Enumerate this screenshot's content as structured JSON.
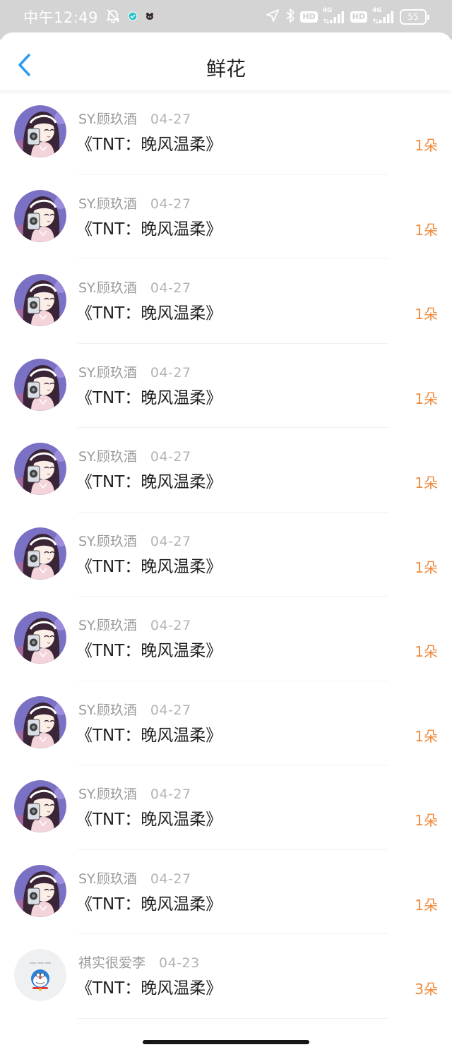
{
  "status_bar": {
    "time": "中午12:49",
    "left_icons": [
      "bell-slash-icon",
      "check-circle-icon",
      "app-notification-icon"
    ],
    "right_icons": [
      "location-arrow-icon",
      "bluetooth-icon"
    ],
    "hd_label": "HD",
    "network_label": "4G",
    "battery_level": "55"
  },
  "header": {
    "title": "鲜花",
    "back_icon": "chevron-left-icon",
    "accent_color": "#2b9cf0"
  },
  "list": {
    "amount_color": "#f08a3c",
    "items": [
      {
        "avatar": "anime-girl-avatar",
        "name": "SY.顾玖酒",
        "date": "04-27",
        "title": "《TNT：晚风温柔》",
        "amount": "1朵"
      },
      {
        "avatar": "anime-girl-avatar",
        "name": "SY.顾玖酒",
        "date": "04-27",
        "title": "《TNT：晚风温柔》",
        "amount": "1朵"
      },
      {
        "avatar": "anime-girl-avatar",
        "name": "SY.顾玖酒",
        "date": "04-27",
        "title": "《TNT：晚风温柔》",
        "amount": "1朵"
      },
      {
        "avatar": "anime-girl-avatar",
        "name": "SY.顾玖酒",
        "date": "04-27",
        "title": "《TNT：晚风温柔》",
        "amount": "1朵"
      },
      {
        "avatar": "anime-girl-avatar",
        "name": "SY.顾玖酒",
        "date": "04-27",
        "title": "《TNT：晚风温柔》",
        "amount": "1朵"
      },
      {
        "avatar": "anime-girl-avatar",
        "name": "SY.顾玖酒",
        "date": "04-27",
        "title": "《TNT：晚风温柔》",
        "amount": "1朵"
      },
      {
        "avatar": "anime-girl-avatar",
        "name": "SY.顾玖酒",
        "date": "04-27",
        "title": "《TNT：晚风温柔》",
        "amount": "1朵"
      },
      {
        "avatar": "anime-girl-avatar",
        "name": "SY.顾玖酒",
        "date": "04-27",
        "title": "《TNT：晚风温柔》",
        "amount": "1朵"
      },
      {
        "avatar": "anime-girl-avatar",
        "name": "SY.顾玖酒",
        "date": "04-27",
        "title": "《TNT：晚风温柔》",
        "amount": "1朵"
      },
      {
        "avatar": "anime-girl-avatar",
        "name": "SY.顾玖酒",
        "date": "04-27",
        "title": "《TNT：晚风温柔》",
        "amount": "1朵"
      },
      {
        "avatar": "doraemon-avatar",
        "name": "祺实很爱李",
        "date": "04-23",
        "title": "《TNT：晚风温柔》",
        "amount": "3朵"
      }
    ]
  }
}
